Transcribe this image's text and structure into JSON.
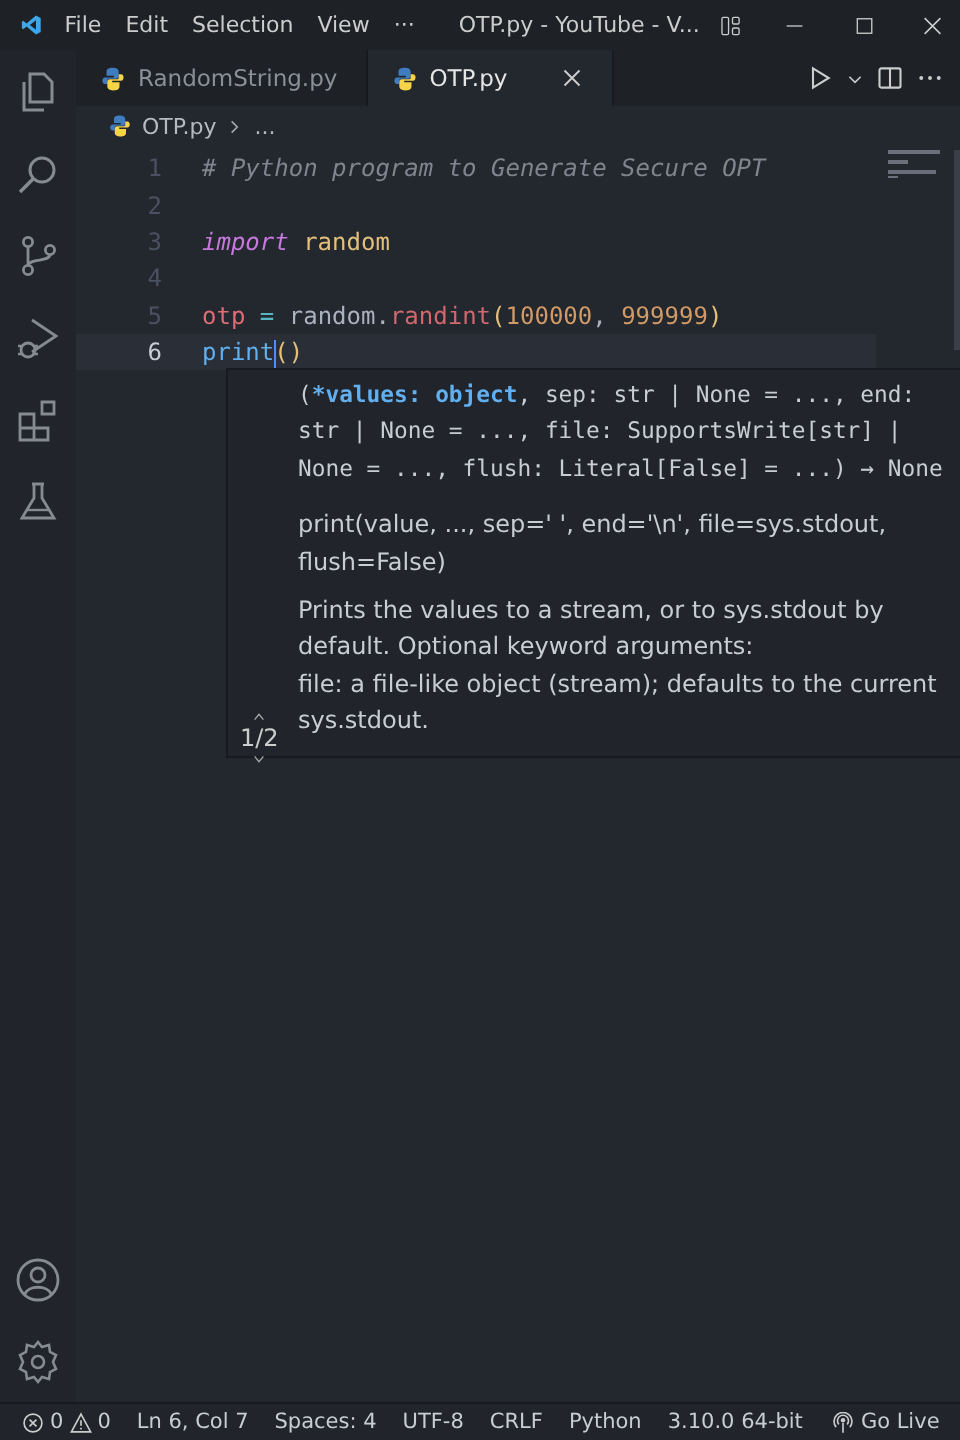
{
  "title_bar": {
    "menu": [
      "File",
      "Edit",
      "Selection",
      "View",
      "···"
    ],
    "title": "OTP.py - YouTube - V..."
  },
  "tabs": [
    {
      "label": "RandomString.py",
      "selected": false
    },
    {
      "label": "OTP.py",
      "selected": true
    }
  ],
  "breadcrumb": [
    "OTP.py",
    "..."
  ],
  "editor": {
    "lines": [
      {
        "number": "1",
        "current": false,
        "tokens": [
          {
            "kind": "comment",
            "text": "# Python program to Generate Secure OPT"
          }
        ]
      },
      {
        "number": "2",
        "current": false
      },
      {
        "number": "3",
        "current": false,
        "tokens": [
          {
            "kind": "keyword",
            "text": "import"
          },
          {
            "kind": "module",
            "text": " random"
          }
        ]
      },
      {
        "number": "4",
        "current": false
      },
      {
        "number": "5",
        "current": false,
        "tokens": [
          {
            "kind": "variable",
            "text": "otp"
          },
          {
            "kind": "operator",
            "text": " = "
          },
          {
            "kind": "plain",
            "text": "random."
          },
          {
            "kind": "function",
            "text": "randint"
          },
          {
            "kind": "bracket",
            "text": "("
          },
          {
            "kind": "number",
            "text": "100000"
          },
          {
            "kind": "plain",
            "text": ", "
          },
          {
            "kind": "number",
            "text": "999999"
          },
          {
            "kind": "bracket",
            "text": ")"
          }
        ]
      },
      {
        "number": "6",
        "current": true,
        "tokens": [
          {
            "kind": "builtin",
            "text": "print"
          },
          {
            "kind": "bracket",
            "text": "()"
          }
        ]
      }
    ]
  },
  "hover": {
    "signature": [
      {
        "kind": "plain",
        "text": "("
      },
      {
        "kind": "param",
        "text": "*values: object"
      },
      {
        "kind": "plain",
        "text": ", sep: str | None = ..., end: str | None = ..., file: SupportsWrite[str] | None = ..., flush: Literal[False] = ...) → None"
      }
    ],
    "usage": "print(value, ..., sep=' ', end='\\n', file=sys.stdout, flush=False)",
    "doc": [
      "Prints the values to a stream, or to sys.stdout by default. Optional keyword arguments:",
      "file: a file-like object (stream); defaults to the current sys.stdout."
    ],
    "pager": "1/2"
  },
  "status_bar": {
    "errors": "0",
    "warnings": "0",
    "items": [
      "Ln 6, Col 7",
      "Spaces: 4",
      "UTF-8",
      "CRLF",
      "Python",
      "3.10.0 64-bit"
    ],
    "go_live": "Go Live"
  }
}
